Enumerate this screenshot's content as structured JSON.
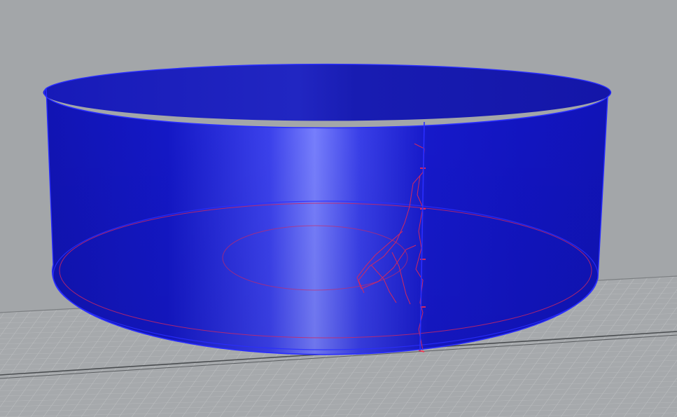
{
  "viewport": {
    "background_color": "#a3a6a9",
    "grid_color": "#c4c6c8",
    "grid_major_color": "#8e9194"
  },
  "object": {
    "shape": "cylinder",
    "selected": true,
    "fill_color": "#1416c8",
    "highlight_color": "#7e86ff",
    "edge_color": "#1a1cff",
    "seam_color": "#1a1cff"
  },
  "inner_curves": {
    "color": "#d02860",
    "description_visible": false
  }
}
